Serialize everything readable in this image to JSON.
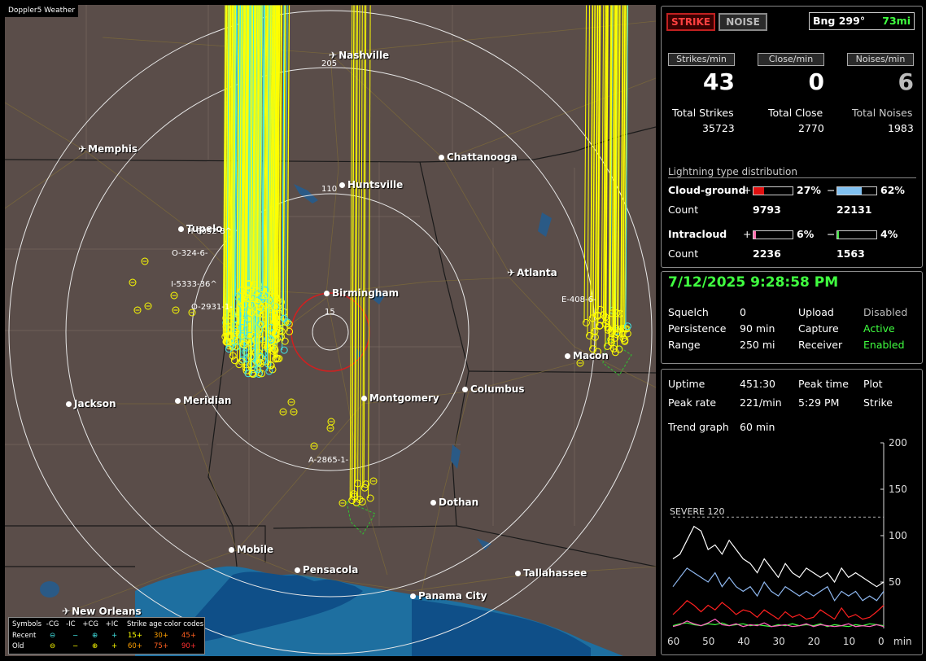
{
  "map": {
    "title": "Doppler5 Weather",
    "cities": [
      {
        "name": "Nashville",
        "type": "plane"
      },
      {
        "name": "Memphis",
        "type": "plane"
      },
      {
        "name": "Chattanooga",
        "type": "dot"
      },
      {
        "name": "Huntsville",
        "type": "dot"
      },
      {
        "name": "Tupelo",
        "type": "dot"
      },
      {
        "name": "Birmingham",
        "type": "dot"
      },
      {
        "name": "Atlanta",
        "type": "plane"
      },
      {
        "name": "Macon",
        "type": "dot"
      },
      {
        "name": "Columbus",
        "type": "dot"
      },
      {
        "name": "Montgomery",
        "type": "dot"
      },
      {
        "name": "Meridian",
        "type": "dot"
      },
      {
        "name": "Jackson",
        "type": "dot"
      },
      {
        "name": "Dothan",
        "type": "dot"
      },
      {
        "name": "Mobile",
        "type": "dot"
      },
      {
        "name": "Pensacola",
        "type": "dot"
      },
      {
        "name": "Tallahassee",
        "type": "dot"
      },
      {
        "name": "Panama City",
        "type": "dot"
      },
      {
        "name": "New Orleans",
        "type": "plane"
      }
    ],
    "range_labels": [
      "205",
      "110",
      "15"
    ],
    "cell_labels": [
      "H-6052-8^",
      "O-324-6-",
      "I-5333-36^",
      "O-2931-1-",
      "E-408-6-",
      "A-2865-1-"
    ]
  },
  "legend": {
    "symbols_label": "Symbols",
    "cols": [
      "-CG",
      "-IC",
      "+CG",
      "+IC"
    ],
    "age_label": "Strike age color codes",
    "recent_label": "Recent",
    "old_label": "Old",
    "recent_ages": [
      "15+",
      "30+",
      "45+"
    ],
    "old_ages": [
      "60+",
      "75+",
      "90+"
    ],
    "age_colors": [
      "#ffff00",
      "#ffa000",
      "#ff6020",
      "#ff3030",
      "#ff3030",
      "#ff3030"
    ]
  },
  "status": {
    "strike_label": "STRIKE",
    "noise_label": "NOISE",
    "bearing_label": "Bng 299°",
    "bearing_dist": "73mi",
    "strikes_min_label": "Strikes/min",
    "close_min_label": "Close/min",
    "noises_min_label": "Noises/min",
    "strikes_min": "43",
    "close_min": "0",
    "noises_min": "6",
    "total_strikes_label": "Total Strikes",
    "total_close_label": "Total Close",
    "total_noises_label": "Total Noises",
    "total_strikes": "35723",
    "total_close": "2770",
    "total_noises": "1983",
    "dist_title": "Lightning type distribution",
    "cg_label": "Cloud-ground",
    "ic_label": "Intracloud",
    "count_label": "Count",
    "plus": "+",
    "minus": "−",
    "cg_pos_pct": "27%",
    "cg_neg_pct": "62%",
    "cg_pos_count": "9793",
    "cg_neg_count": "22131",
    "ic_pos_pct": "6%",
    "ic_neg_pct": "4%",
    "ic_pos_count": "2236",
    "ic_neg_count": "1563",
    "cg_pos_frac": 0.27,
    "cg_neg_frac": 0.62,
    "ic_pos_frac": 0.06,
    "ic_neg_frac": 0.04
  },
  "settings": {
    "datetime": "7/12/2025 9:28:58 PM",
    "squelch_label": "Squelch",
    "squelch": "0",
    "persistence_label": "Persistence",
    "persistence": "90 min",
    "range_label": "Range",
    "range": "250 mi",
    "upload_label": "Upload",
    "upload": "Disabled",
    "capture_label": "Capture",
    "capture": "Active",
    "receiver_label": "Receiver",
    "receiver": "Enabled"
  },
  "trend": {
    "uptime_label": "Uptime",
    "uptime": "451:30",
    "peak_time_label": "Peak time",
    "peak_time": "5:29 PM",
    "plot_label": "Plot",
    "plot_value": "Strike",
    "peak_rate_label": "Peak rate",
    "peak_rate": "221/min",
    "trend_label": "Trend graph",
    "trend_value": "60 min",
    "severe_label": "SEVERE 120",
    "y_ticks": [
      "200",
      "150",
      "100",
      "50"
    ],
    "x_ticks": [
      "60",
      "50",
      "40",
      "30",
      "20",
      "10",
      "0"
    ],
    "x_unit": "min"
  },
  "chart_data": {
    "type": "line",
    "title": "",
    "xlabel": "min",
    "ylabel": "",
    "xlim": [
      60,
      0
    ],
    "ylim": [
      0,
      200
    ],
    "x": [
      60,
      58,
      56,
      54,
      52,
      50,
      48,
      46,
      44,
      42,
      40,
      38,
      36,
      34,
      32,
      30,
      28,
      26,
      24,
      22,
      20,
      18,
      16,
      14,
      12,
      10,
      8,
      6,
      4,
      2,
      0
    ],
    "series": [
      {
        "color": "#ffffff",
        "values": [
          75,
          80,
          95,
          110,
          105,
          85,
          90,
          80,
          95,
          85,
          75,
          70,
          60,
          75,
          65,
          55,
          70,
          60,
          55,
          65,
          60,
          55,
          60,
          50,
          65,
          55,
          60,
          55,
          50,
          45,
          50
        ]
      },
      {
        "color": "#8fb8f0",
        "values": [
          45,
          55,
          65,
          60,
          55,
          50,
          60,
          45,
          55,
          45,
          40,
          45,
          35,
          50,
          40,
          35,
          45,
          40,
          35,
          40,
          35,
          40,
          45,
          30,
          40,
          35,
          40,
          30,
          35,
          30,
          40
        ]
      },
      {
        "color": "#ff2020",
        "values": [
          15,
          22,
          30,
          25,
          18,
          25,
          20,
          28,
          22,
          15,
          20,
          18,
          12,
          20,
          15,
          10,
          18,
          12,
          15,
          10,
          12,
          20,
          15,
          10,
          22,
          12,
          15,
          10,
          12,
          18,
          25
        ]
      },
      {
        "color": "#40ff40",
        "values": [
          3,
          5,
          6,
          4,
          3,
          5,
          4,
          6,
          3,
          4,
          5,
          3,
          4,
          3,
          2,
          4,
          3,
          5,
          3,
          4,
          3,
          5,
          2,
          4,
          3,
          2,
          4,
          3,
          5,
          4,
          3
        ]
      },
      {
        "color": "#ff60c0",
        "values": [
          2,
          4,
          8,
          5,
          3,
          6,
          10,
          4,
          3,
          5,
          2,
          4,
          3,
          6,
          2,
          3,
          4,
          2,
          3,
          5,
          2,
          4,
          3,
          2,
          3,
          5,
          2,
          3,
          2,
          4,
          2
        ]
      }
    ],
    "severe_threshold": 120
  }
}
